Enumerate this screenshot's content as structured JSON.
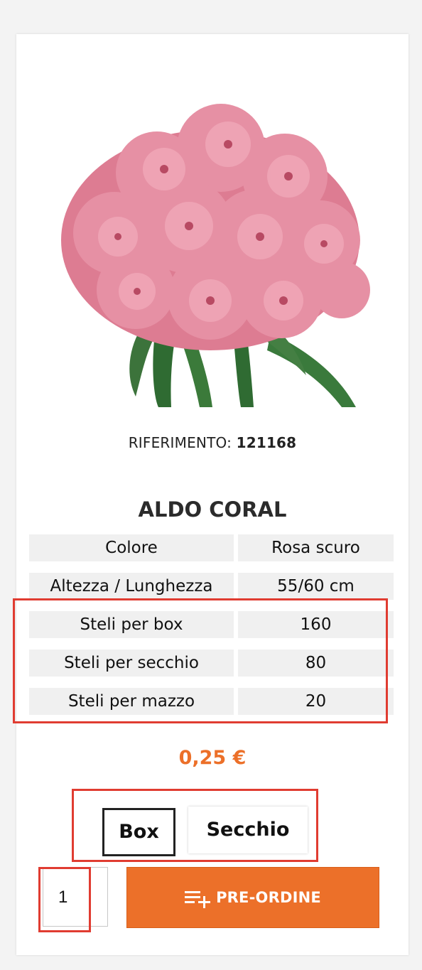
{
  "product": {
    "image_alt": "Pink carnation bunch",
    "reference_label": "RIFERIMENTO:",
    "reference_value": "121168",
    "name": "ALDO CORAL",
    "price": "0,25 €"
  },
  "specs": [
    {
      "label": "Colore",
      "value": "Rosa scuro"
    },
    {
      "label": "Altezza / Lunghezza",
      "value": "55/60 cm"
    },
    {
      "label": "Steli per box",
      "value": "160"
    },
    {
      "label": "Steli per secchio",
      "value": "80"
    },
    {
      "label": "Steli per mazzo",
      "value": "20"
    }
  ],
  "options": {
    "box_label": "Box",
    "secchio_label": "Secchio",
    "selected": "Box"
  },
  "cart": {
    "quantity": "1",
    "button_label": "PRE-ORDINE",
    "button_icon": "playlist-add-icon"
  },
  "colors": {
    "accent": "#ec7029",
    "highlight": "#e03c31",
    "spec_bg": "#f0f0f0"
  }
}
